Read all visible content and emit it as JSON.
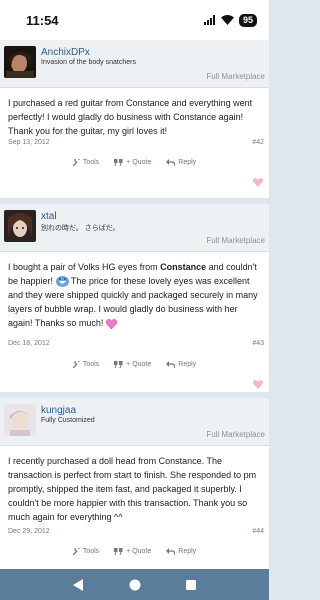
{
  "status": {
    "time": "11:54",
    "battery": "95"
  },
  "posts": [
    {
      "username": "AnchixDPx",
      "usertitle": "Invasion of the body snatchers",
      "role": "Full Marketplace",
      "message": "I purchased a red guitar from Constance and everything went perfectly! I would gladly do business with Constance again! Thank you for the guitar, my girl loves it!",
      "date": "Sep 13, 2012",
      "number": "#42"
    },
    {
      "username": "xtal",
      "usertitle": "別れの時だ。 さらばだ。",
      "role": "Full Marketplace",
      "message_a": "I bought a pair of Volks HG eyes from ",
      "message_bold": "Constance",
      "message_b": " and couldn't be happier! ",
      "message_c": " The price for these lovely eyes was excellent and they were shipped quickly and packaged securely in many layers of bubble wrap. I would gladly do business with her again! Thanks so much! ",
      "date": "Dec 18, 2012",
      "number": "#43"
    },
    {
      "username": "kungjaa",
      "usertitle": "Fully Customized",
      "role": "Full Marketplace",
      "message": "I recently purchased a doll head from Constance. The transaction is perfect from start to finish. She responded to pm promptly, shipped the item fast, and packaged it superbly. I couldn't be more happier with this transaction. Thank you so much again for everything ^^",
      "date": "Dec 29, 2012",
      "number": "#44"
    }
  ],
  "actions": {
    "tools": "Tools",
    "quote": "+ Quote",
    "reply": "Reply"
  },
  "colors": {
    "header_bg": "#eef1f4",
    "username": "#2a5c8c",
    "nav_bar": "#5b7d9a",
    "heart": "#f4b9c4"
  },
  "icons": [
    "wrench-icon",
    "quote-icon",
    "reply-icon",
    "heart-icon",
    "wifi-icon",
    "signal-icon",
    "battery-icon",
    "back-icon",
    "home-icon",
    "recents-icon"
  ]
}
